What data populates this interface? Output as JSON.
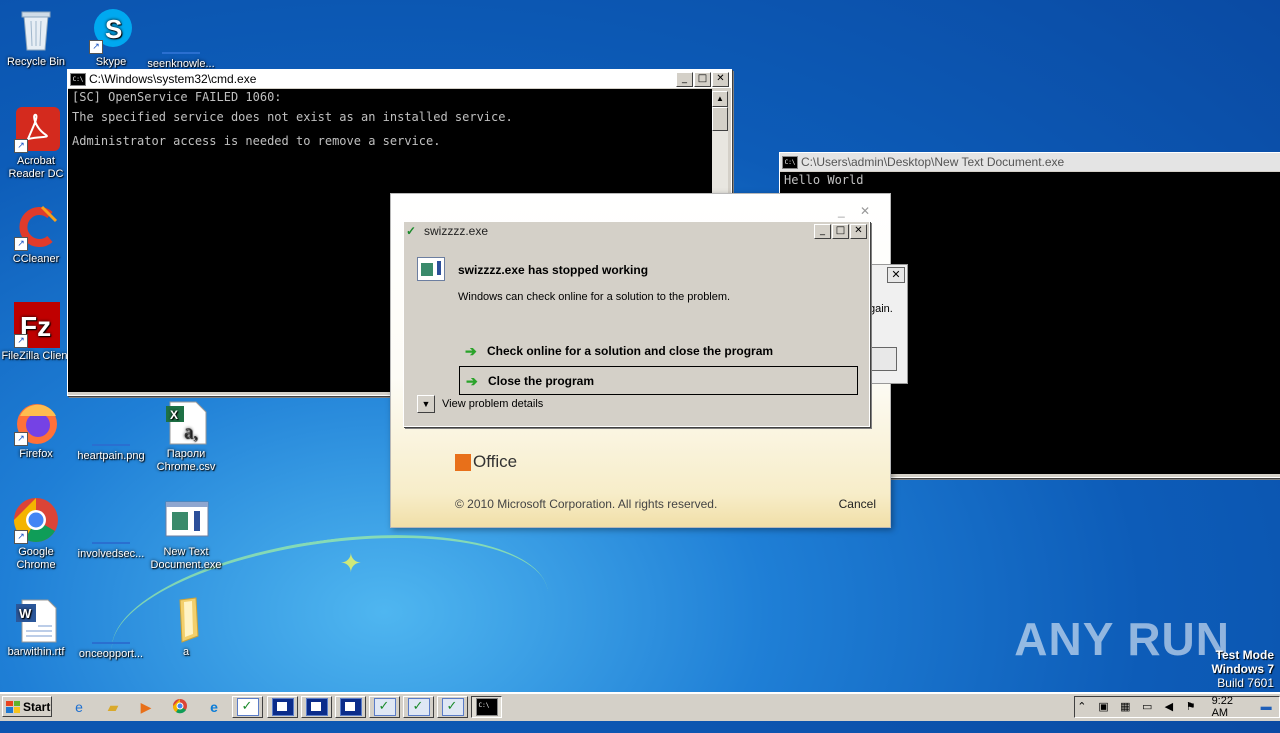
{
  "desktop": {
    "icons": [
      {
        "label": "Recycle Bin"
      },
      {
        "label": "Skype"
      },
      {
        "label": "seenknowle..."
      },
      {
        "label": "Acrobat Reader DC"
      },
      {
        "label": "CCleaner"
      },
      {
        "label": "FileZilla Client"
      },
      {
        "label": "Firefox"
      },
      {
        "label": "heartpain.png"
      },
      {
        "label": "Пароли Chrome.csv"
      },
      {
        "label": "Google Chrome"
      },
      {
        "label": "involvedsec..."
      },
      {
        "label": "New Text Document.exe"
      },
      {
        "label": "barwithin.rtf"
      },
      {
        "label": "onceopport..."
      },
      {
        "label": "a"
      }
    ]
  },
  "cmd_main": {
    "title": "C:\\Windows\\system32\\cmd.exe",
    "lines": [
      "[SC] OpenService FAILED 1060:",
      "The specified service does not exist as an installed service.",
      "Administrator access is needed to remove a service."
    ]
  },
  "cmd_second": {
    "title": "C:\\Users\\admin\\Desktop\\New Text Document.exe",
    "lines": [
      "Hello World"
    ]
  },
  "hidden_dialog": {
    "partial_text": "gain."
  },
  "office_splash": {
    "brand": "Office",
    "copyright": "© 2010 Microsoft Corporation.  All rights reserved.",
    "cancel_label": "Cancel"
  },
  "error_dialog": {
    "title": "swizzzz.exe",
    "heading": "swizzzz.exe has stopped working",
    "message": "Windows can check online for a solution to the problem.",
    "option_check_online": "Check online for a solution and close the program",
    "option_close": "Close the program",
    "details_label": "View problem details"
  },
  "taskbar": {
    "start_label": "Start",
    "clock": "9:22 AM"
  },
  "watermark": {
    "text": "ANY RUN"
  },
  "test_mode": {
    "line1": "Test Mode",
    "line2": "Windows 7",
    "line3": "Build 7601"
  },
  "colors": {
    "desktop_blue": "#0d5cb8",
    "console_bg": "#000000",
    "dialog_gray": "#d4d0c8",
    "office_orange": "#e8701a",
    "green_arrow": "#2aa32a"
  }
}
